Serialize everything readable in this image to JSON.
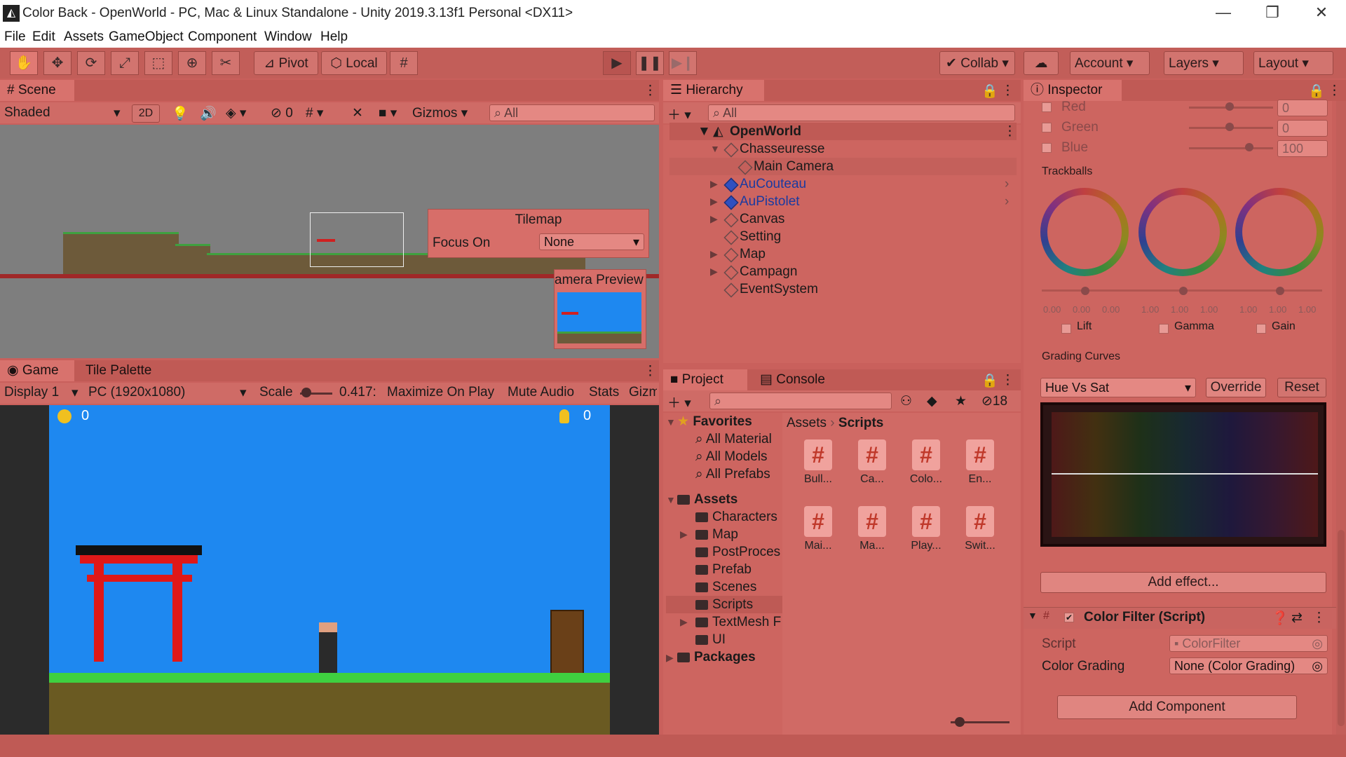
{
  "window": {
    "title": "Color Back - OpenWorld - PC, Mac & Linux Standalone - Unity 2019.3.13f1 Personal <DX11>",
    "controls": [
      "—",
      "❐",
      "✕"
    ]
  },
  "menu": [
    "File",
    "Edit",
    "Assets",
    "GameObject",
    "Component",
    "Window",
    "Help"
  ],
  "toolbar": {
    "pivot": "Pivot",
    "local": "Local",
    "collab": "Collab",
    "account": "Account",
    "layers": "Layers",
    "layout": "Layout"
  },
  "scene": {
    "tab": "Scene",
    "shading": "Shaded",
    "mode_2d": "2D",
    "hidden_count": "0",
    "gizmos": "Gizmos",
    "search_placeholder": "All",
    "tilemap_overlay": {
      "title": "Tilemap",
      "focus_label": "Focus On",
      "focus_value": "None"
    },
    "camera_preview_label": "amera Preview"
  },
  "game": {
    "tabs": [
      "Game",
      "Tile Palette"
    ],
    "display": "Display 1",
    "resolution": "PC (1920x1080)",
    "scale_label": "Scale",
    "scale_value": "0.417:",
    "maximize": "Maximize On Play",
    "mute": "Mute Audio",
    "stats": "Stats",
    "gizmos": "Gizm",
    "hud_coins": "0",
    "hud_keys": "0"
  },
  "hierarchy": {
    "tab": "Hierarchy",
    "search_placeholder": "All",
    "scene_name": "OpenWorld",
    "items": [
      {
        "label": "Chasseuresse",
        "depth": 1,
        "expanded": true,
        "prefab": false
      },
      {
        "label": "Main Camera",
        "depth": 2,
        "expanded": false,
        "prefab": false
      },
      {
        "label": "AuCouteau",
        "depth": 1,
        "expanded": false,
        "prefab": true
      },
      {
        "label": "AuPistolet",
        "depth": 1,
        "expanded": false,
        "prefab": true
      },
      {
        "label": "Canvas",
        "depth": 1,
        "expanded": false,
        "prefab": false
      },
      {
        "label": "Setting",
        "depth": 1,
        "expanded": false,
        "prefab": false
      },
      {
        "label": "Map",
        "depth": 1,
        "expanded": false,
        "prefab": false
      },
      {
        "label": "Campagn",
        "depth": 1,
        "expanded": false,
        "prefab": false
      },
      {
        "label": "EventSystem",
        "depth": 1,
        "expanded": false,
        "prefab": false
      }
    ]
  },
  "project": {
    "tabs": [
      "Project",
      "Console"
    ],
    "hidden_count": "18",
    "favorites_label": "Favorites",
    "favorites": [
      "All Material",
      "All Models",
      "All Prefabs"
    ],
    "assets_label": "Assets",
    "folders": [
      "Characters",
      "Map",
      "PostProces",
      "Prefab",
      "Scenes",
      "Scripts",
      "TextMesh F",
      "UI"
    ],
    "packages_label": "Packages",
    "breadcrumb": [
      "Assets",
      "Scripts"
    ],
    "scripts": [
      "Bull...",
      "Ca...",
      "Colo...",
      "En...",
      "Mai...",
      "Ma...",
      "Play...",
      "Swit..."
    ]
  },
  "inspector": {
    "tab": "Inspector",
    "channels": [
      {
        "label": "Red",
        "value": "0"
      },
      {
        "label": "Green",
        "value": "0"
      },
      {
        "label": "Blue",
        "value": "100"
      }
    ],
    "trackballs_label": "Trackballs",
    "trackball_values": [
      "0.00",
      "0.00",
      "0.00",
      "1.00",
      "1.00",
      "1.00",
      "1.00",
      "1.00",
      "1.00"
    ],
    "trackballs": [
      "Lift",
      "Gamma",
      "Gain"
    ],
    "grading_curves_label": "Grading Curves",
    "curve_mode": "Hue Vs Sat",
    "override": "Override",
    "reset": "Reset",
    "add_effect": "Add effect...",
    "component_title": "Color Filter (Script)",
    "script_label": "Script",
    "script_value": "ColorFilter",
    "grading_label": "Color Grading",
    "grading_value": "None (Color Grading)",
    "add_component": "Add Component"
  }
}
